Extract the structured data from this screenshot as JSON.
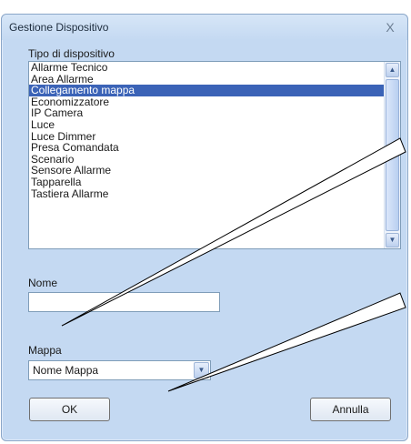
{
  "dialog": {
    "title": "Gestione Dispositivo",
    "close_glyph": "X"
  },
  "device_type": {
    "label": "Tipo di dispositivo",
    "items": [
      "Allarme Tecnico",
      "Area Allarme",
      "Collegamento mappa",
      "Economizzatore",
      "IP Camera",
      "Luce",
      "Luce Dimmer",
      "Presa Comandata",
      "Scenario",
      "Sensore Allarme",
      "Tapparella",
      "Tastiera Allarme"
    ],
    "selected": "Collegamento mappa",
    "scroll_up_glyph": "▲",
    "scroll_down_glyph": "▼"
  },
  "name_field": {
    "label": "Nome",
    "value": ""
  },
  "map_field": {
    "label": "Mappa",
    "selected_value": "Nome Mappa",
    "arrow_glyph": "▼"
  },
  "buttons": {
    "ok_label": "OK",
    "cancel_label": "Annulla"
  },
  "colors": {
    "dialog_background": "#c4d9f2",
    "selection": "#3b63b7"
  }
}
